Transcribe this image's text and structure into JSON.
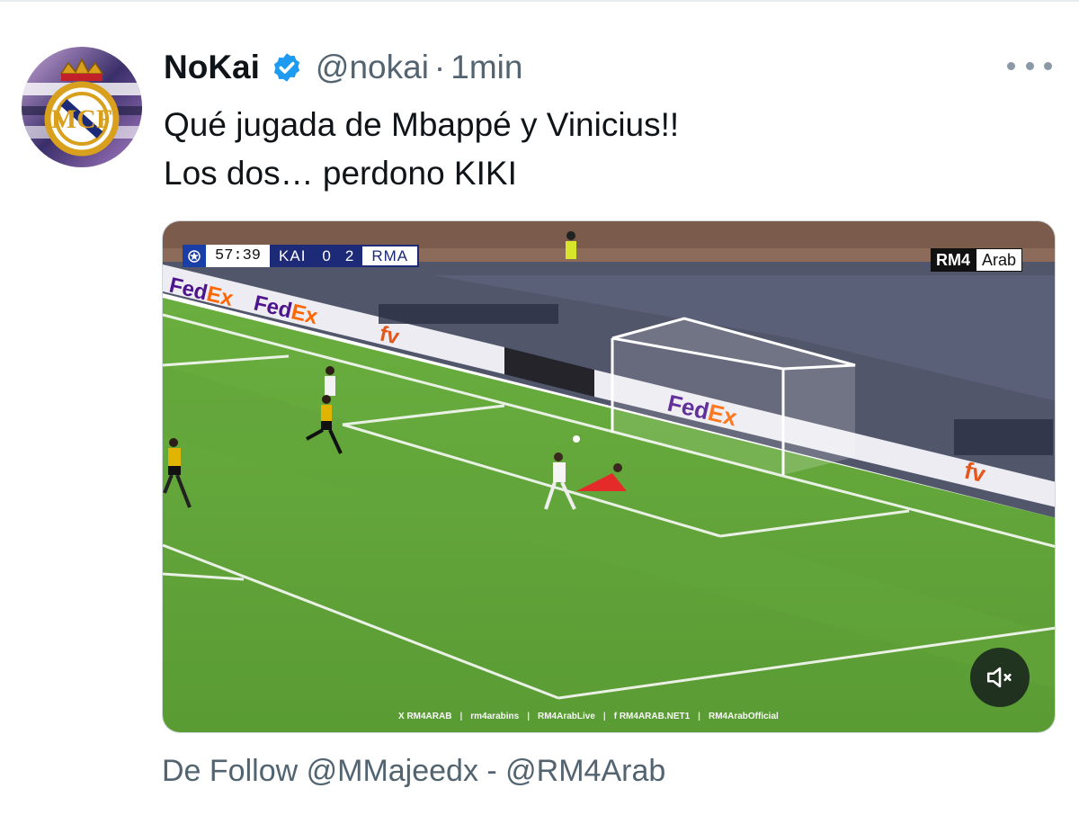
{
  "post": {
    "author_name": "NoKai",
    "handle": "@nokai",
    "separator": "·",
    "time": "1min",
    "text_lines": [
      "Qué jugada de Mbappé y Vinicius!!",
      "Los dos… perdono KIKI"
    ],
    "credit": "De Follow @MMajeedx - @RM4Arab"
  },
  "video": {
    "clock": "57:39",
    "home_team": "KAI",
    "home_score": "0",
    "away_score": "2",
    "away_team": "RMA",
    "watermark_a": "RM4",
    "watermark_b": "Arab",
    "ads": [
      "FedEx",
      "FedEx",
      "fv",
      "FedEx",
      "fv"
    ],
    "socials": [
      "X RM4ARAB",
      "rm4arabins",
      "RM4ArabLive",
      "f RM4ARAB.NET1",
      "RM4ArabOfficial"
    ]
  },
  "icons": {
    "verified": "verified-badge-icon",
    "more": "more-dots-icon",
    "mute": "volume-muted-icon"
  },
  "colors": {
    "verified": "#1d9bf0",
    "secondary_text": "#536471",
    "pitch": "#5fa23a"
  }
}
